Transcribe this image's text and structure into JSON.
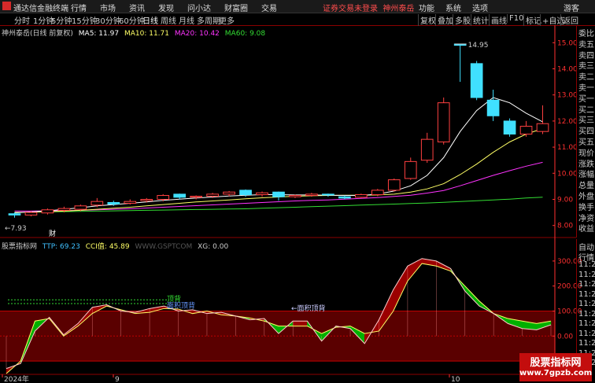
{
  "app": {
    "title": "通达信金融终端",
    "menus": [
      "行情",
      "市场",
      "资讯",
      "发现",
      "问小达",
      "财富圈",
      "交易"
    ],
    "notice": "证券交易未登录",
    "stock_name": "神州泰岳",
    "right_menus": [
      "功能",
      "系统",
      "选项"
    ],
    "guest": "游客"
  },
  "periods": [
    "分时",
    "1分钟",
    "5分钟",
    "15分钟",
    "30分钟",
    "60分钟",
    "日线",
    "周线",
    "月线",
    "多周期",
    "更多"
  ],
  "active_period": "日线",
  "tools": [
    "复权",
    "叠加",
    "多股",
    "统计",
    "画线",
    "F10",
    "标记",
    "+自选",
    "返回"
  ],
  "main_info": {
    "label": "神州泰岳(日线 前复权)",
    "ma5": "MA5: 11.97",
    "ma10": "MA10: 11.71",
    "ma20": "MA20: 10.42",
    "ma60": "MA60: 9.08",
    "high_label": "14.95",
    "low_label": "7.93",
    "fin_label": "财"
  },
  "price_axis": [
    "15.00",
    "14.00",
    "13.00",
    "12.00",
    "11.00",
    "10.00",
    "9.00",
    "8.00"
  ],
  "ind_info": {
    "name": "股票指标网",
    "ttp": "TTP: 69.23",
    "cci": "CCI值: 45.89",
    "site": "WWW.GSPTCOM",
    "xg": "XG: 0.00",
    "annot1": "顶背",
    "annot2": "面积顶背",
    "annot3": "←面积顶背"
  },
  "ind_axis": [
    "300.00",
    "200.00",
    "100.00",
    "0.00",
    "-100.00"
  ],
  "time_axis": [
    "2024年",
    "9",
    "10"
  ],
  "right_panel_top": [
    "委比",
    "卖五",
    "卖四",
    "卖三",
    "卖二",
    "卖一",
    "买一",
    "买二",
    "买三",
    "买四",
    "买五",
    "现价",
    "涨跌",
    "涨幅",
    "总量",
    "外盘",
    "换手",
    "净资",
    "收益"
  ],
  "right_panel_bottom": [
    "自动",
    "行情",
    "11:26",
    "11:26",
    "11:26",
    "11:26",
    "11:26",
    "11:26",
    "11:26",
    "11:26",
    "11:26",
    "11:26",
    "11:26"
  ],
  "watermark": {
    "line1": "股票指标网",
    "line2": "www.7gpzb.com"
  },
  "colors": {
    "up": "#ff4040",
    "down": "#40e0ff",
    "ma5": "#ffffff",
    "ma10": "#ffff66",
    "ma20": "#ff33ff",
    "ma60": "#33dd33",
    "axis": "#ff3030",
    "ttp_area_up": "#9b0000",
    "ttp_area_down": "#00b000",
    "band": "#5a0000"
  },
  "chart_data": {
    "type": "candlestick",
    "candles": [
      [
        8.45,
        8.4,
        8.5,
        8.3
      ],
      [
        8.4,
        8.5,
        8.55,
        8.35
      ],
      [
        8.48,
        8.6,
        8.65,
        8.42
      ],
      [
        8.58,
        8.65,
        8.72,
        8.5
      ],
      [
        8.62,
        8.75,
        8.8,
        8.55
      ],
      [
        8.78,
        8.92,
        9.05,
        8.7
      ],
      [
        8.88,
        8.82,
        8.95,
        8.75
      ],
      [
        8.85,
        8.92,
        9.0,
        8.8
      ],
      [
        8.95,
        9.0,
        9.05,
        8.88
      ],
      [
        9.0,
        9.15,
        9.2,
        8.92
      ],
      [
        9.2,
        9.08,
        9.22,
        9.0
      ],
      [
        9.08,
        9.12,
        9.15,
        9.0
      ],
      [
        9.12,
        9.2,
        9.25,
        9.05
      ],
      [
        9.2,
        9.28,
        9.32,
        9.12
      ],
      [
        9.35,
        9.18,
        9.38,
        9.1
      ],
      [
        9.18,
        9.25,
        9.3,
        9.1
      ],
      [
        9.28,
        9.1,
        9.3,
        8.95
      ],
      [
        9.1,
        9.15,
        9.18,
        9.05
      ],
      [
        9.15,
        9.2,
        9.25,
        9.1
      ],
      [
        9.2,
        9.18,
        9.22,
        9.1
      ],
      [
        9.1,
        9.05,
        9.15,
        9.0
      ],
      [
        9.08,
        9.18,
        9.22,
        9.05
      ],
      [
        9.18,
        9.35,
        9.4,
        9.12
      ],
      [
        9.35,
        9.75,
        9.8,
        9.3
      ],
      [
        9.8,
        10.45,
        10.6,
        9.75
      ],
      [
        10.5,
        11.3,
        11.55,
        10.4
      ],
      [
        11.2,
        12.7,
        12.9,
        11.1
      ],
      [
        14.95,
        14.9,
        14.95,
        13.5
      ],
      [
        14.2,
        12.9,
        14.3,
        12.8
      ],
      [
        12.8,
        12.2,
        13.2,
        12.0
      ],
      [
        12.0,
        11.5,
        12.1,
        11.4
      ],
      [
        11.5,
        11.8,
        12.0,
        11.4
      ],
      [
        11.6,
        11.9,
        12.6,
        11.5
      ]
    ],
    "candle_fields": [
      "open",
      "close",
      "high",
      "low"
    ],
    "ma5": [
      8.48,
      8.52,
      8.56,
      8.62,
      8.68,
      8.75,
      8.8,
      8.85,
      8.9,
      8.96,
      9.01,
      9.05,
      9.09,
      9.13,
      9.16,
      9.18,
      9.18,
      9.17,
      9.17,
      9.16,
      9.15,
      9.15,
      9.2,
      9.32,
      9.52,
      9.92,
      10.6,
      11.6,
      12.4,
      12.9,
      12.7,
      12.3,
      11.97
    ],
    "ma10": [
      8.5,
      8.51,
      8.53,
      8.55,
      8.58,
      8.62,
      8.66,
      8.7,
      8.75,
      8.8,
      8.85,
      8.9,
      8.94,
      8.98,
      9.02,
      9.06,
      9.09,
      9.12,
      9.14,
      9.15,
      9.16,
      9.16,
      9.17,
      9.2,
      9.28,
      9.4,
      9.6,
      9.95,
      10.35,
      10.8,
      11.2,
      11.5,
      11.71
    ],
    "ma20": [
      8.55,
      8.55,
      8.56,
      8.57,
      8.58,
      8.6,
      8.62,
      8.64,
      8.67,
      8.7,
      8.73,
      8.76,
      8.79,
      8.82,
      8.85,
      8.88,
      8.91,
      8.94,
      8.96,
      8.98,
      9.01,
      9.04,
      9.07,
      9.11,
      9.16,
      9.24,
      9.34,
      9.52,
      9.72,
      9.92,
      10.1,
      10.27,
      10.42
    ],
    "ma60": [
      8.5,
      8.51,
      8.52,
      8.53,
      8.54,
      8.55,
      8.56,
      8.57,
      8.58,
      8.59,
      8.6,
      8.61,
      8.62,
      8.63,
      8.64,
      8.66,
      8.68,
      8.7,
      8.72,
      8.74,
      8.76,
      8.78,
      8.8,
      8.82,
      8.84,
      8.86,
      8.89,
      8.92,
      8.95,
      8.98,
      9.01,
      9.05,
      9.08
    ],
    "price_range": [
      7.75,
      15.25
    ],
    "ttp": [
      -130,
      -110,
      20,
      75,
      5,
      50,
      115,
      125,
      100,
      95,
      110,
      120,
      100,
      105,
      90,
      95,
      80,
      65,
      70,
      10,
      60,
      60,
      -20,
      40,
      30,
      -30,
      65,
      185,
      280,
      310,
      300,
      270,
      180,
      120,
      90,
      50,
      30,
      25,
      45
    ],
    "cci": [
      -150,
      -100,
      60,
      70,
      0,
      40,
      90,
      120,
      105,
      90,
      95,
      110,
      108,
      90,
      100,
      85,
      80,
      72,
      60,
      40,
      40,
      40,
      10,
      35,
      40,
      10,
      20,
      100,
      220,
      290,
      280,
      260,
      200,
      140,
      90,
      70,
      60,
      50,
      60
    ],
    "ind_range": [
      -150,
      350
    ]
  }
}
